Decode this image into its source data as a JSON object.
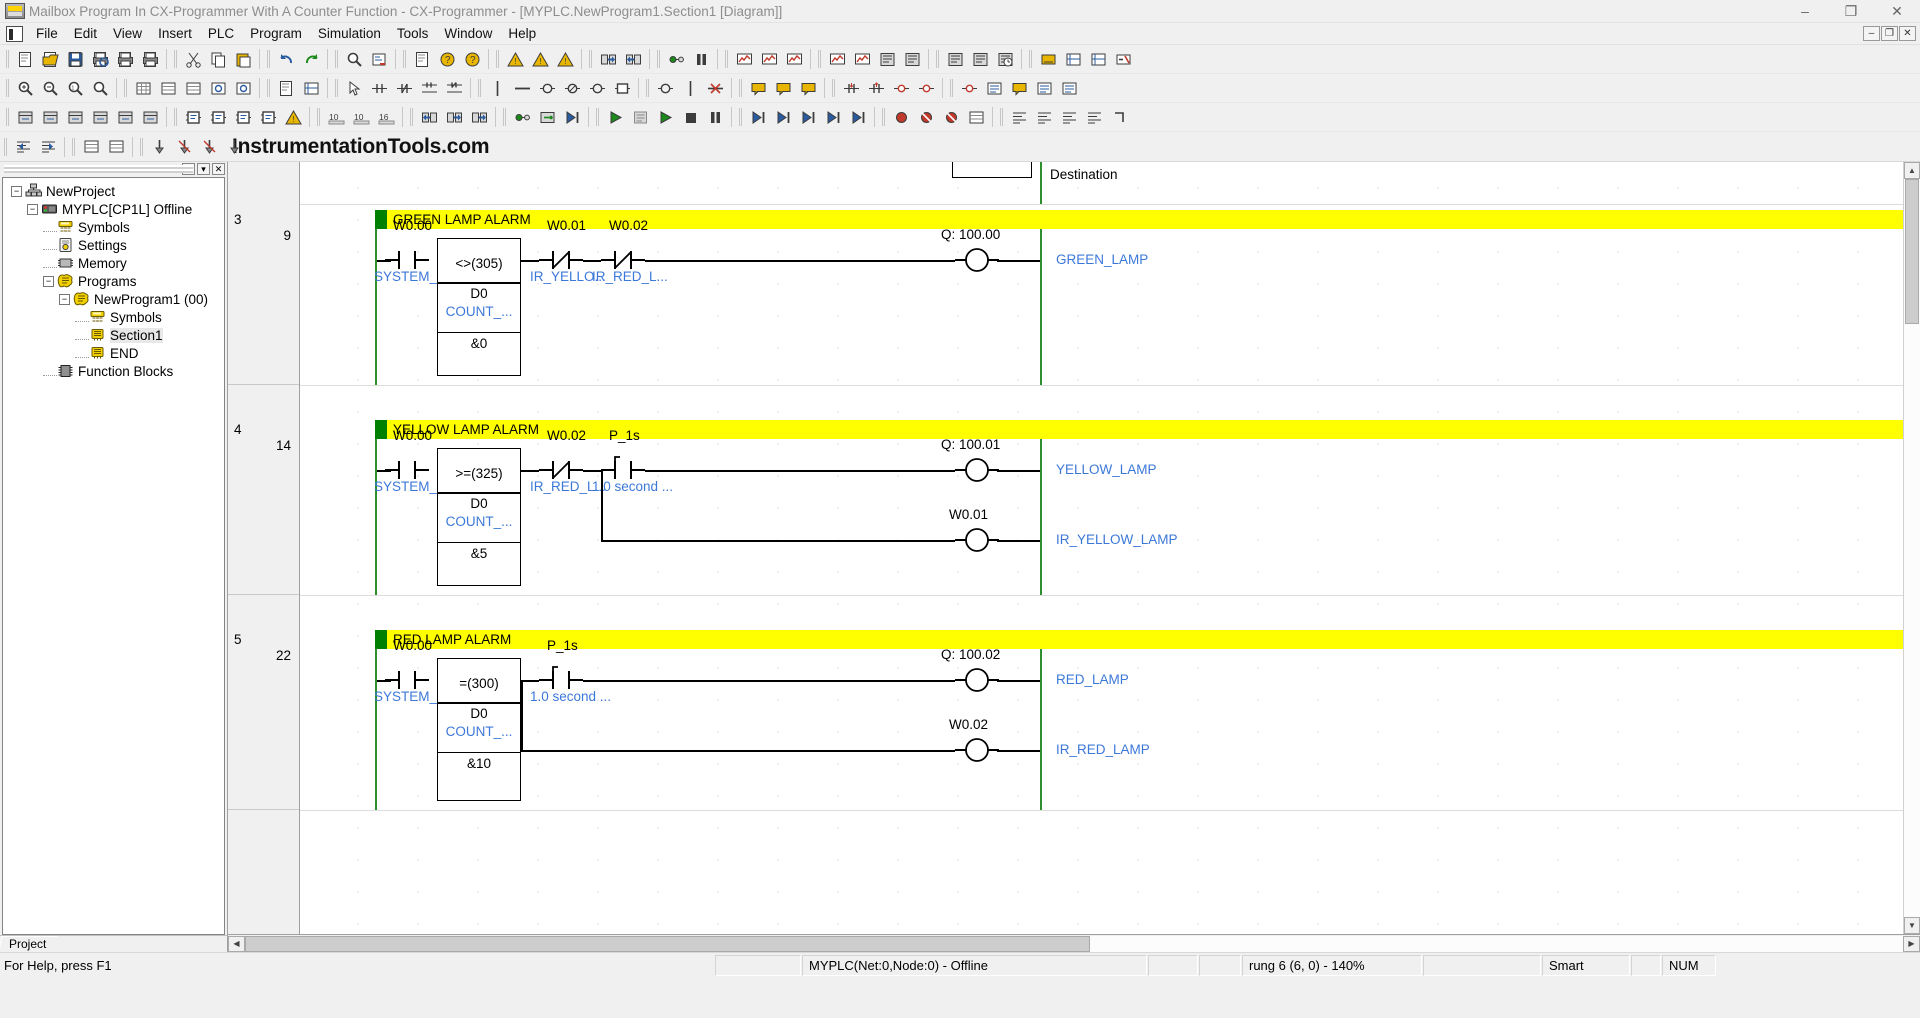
{
  "window": {
    "title": "Mailbox Program In CX-Programmer With A Counter Function - CX-Programmer - [MYPLC.NewProgram1.Section1 [Diagram]]",
    "app_icon": "plc-window-icon",
    "minimize": "–",
    "maximize": "❐",
    "close": "✕"
  },
  "menubar": {
    "icon": "document-icon",
    "items": [
      "File",
      "Edit",
      "View",
      "Insert",
      "PLC",
      "Program",
      "Simulation",
      "Tools",
      "Window",
      "Help"
    ],
    "mdi_buttons": [
      "–",
      "❐",
      "✕"
    ]
  },
  "watermark": {
    "text": "InstrumentationTools.com"
  },
  "toolbars": {
    "row1": [
      "new-icon",
      "open-icon",
      "save-icon",
      "print-preview-icon",
      "print-icon",
      "print-setup-icon",
      "cut-icon",
      "copy-icon",
      "paste-icon",
      "undo-icon",
      "redo-icon",
      "find-icon",
      "replace-icon",
      "properties-icon",
      "help-pointer-icon",
      "context-help-icon",
      "compile-error-icon",
      "compile-program-icon",
      "compile-plc-icon",
      "transfer-to-plc-icon",
      "transfer-from-plc-icon",
      "work-online-icon",
      "pause-icon",
      "monitor-icon",
      "monitor-stop-icon",
      "differential-monitor-icon",
      "data-trace-icon",
      "time-chart-icon",
      "cx-protocol-icon",
      "memory-view-icon",
      "io-table-icon",
      "plc-settings-icon",
      "plc-clock-icon",
      "symbols-icon",
      "address-ref-icon",
      "cross-ref-icon",
      "online-edit-icon"
    ],
    "row2": [
      "zoom-in-icon",
      "zoom-out-icon",
      "zoom-100-icon",
      "zoom-fit-icon",
      "grid-icon",
      "list-icon",
      "list-detail-icon",
      "watch-icon",
      "watch2-icon",
      "mnemonic-icon",
      "address-display-icon",
      "select-mode-icon",
      "new-contact-icon",
      "new-closed-contact-icon",
      "new-contact-or-icon",
      "new-closed-contact-or-icon",
      "new-vertical-icon",
      "new-horizontal-icon",
      "new-coil-icon",
      "new-closed-coil-icon",
      "new-pls-coil-icon",
      "new-instruction-icon",
      "new-output-icon",
      "vertical-line-icon",
      "delete-line-icon",
      "comment-icon",
      "rung-comment-icon",
      "annotation-icon",
      "up-differential-icon",
      "down-differential-icon",
      "invert-icon",
      "force-icon",
      "condition-icon",
      "show-symbol-icon",
      "show-comment-icon",
      "show-bar-icon",
      "show-rung-icon"
    ],
    "row3": [
      "view-1-icon",
      "view-2-icon",
      "view-3-icon",
      "view-4-icon",
      "view-5-icon",
      "view-6-icon",
      "fb-instance-icon",
      "fb-param-icon",
      "fb-ladder-icon",
      "fb-text-icon",
      "fb-compile-icon",
      "decimal-10-icon",
      "decimal-10-signed-icon",
      "hex-16-icon",
      "transfer-up-icon",
      "transfer-down-icon",
      "transfer-all-icon",
      "simulator-online-icon",
      "simulator-icon",
      "step-exec-icon",
      "scan-run-icon",
      "scan-pause-icon",
      "run-icon",
      "stop-icon",
      "pause2-icon",
      "step-in-icon",
      "step-out-icon",
      "step-over-icon",
      "continuous-step-icon",
      "run-to-cursor-icon",
      "break-set-icon",
      "break-clear-icon",
      "break-all-icon",
      "break-list-icon",
      "align-a-icon",
      "align-b-icon",
      "align-c-icon",
      "align-d-icon",
      "corner-icon"
    ],
    "row4": [
      "indent-left-icon",
      "indent-right-icon",
      "align-list-icon",
      "align-list2-icon",
      "pin-icon",
      "pin-off-icon",
      "pin-clear-icon",
      "pin-all-icon"
    ]
  },
  "project_tree": {
    "caption_buttons": [
      "–",
      "▾",
      "✕"
    ],
    "tab": "Project",
    "nodes": [
      {
        "label": "NewProject",
        "indent": 0,
        "expander": "−",
        "icon": "project-icon",
        "selected": false
      },
      {
        "label": "MYPLC[CP1L] Offline",
        "indent": 1,
        "expander": "−",
        "icon": "plc-icon",
        "selected": false
      },
      {
        "label": "Symbols",
        "indent": 2,
        "expander": "",
        "icon": "symbols-icon",
        "selected": false
      },
      {
        "label": "Settings",
        "indent": 2,
        "expander": "",
        "icon": "settings-icon",
        "selected": false
      },
      {
        "label": "Memory",
        "indent": 2,
        "expander": "",
        "icon": "memory-icon",
        "selected": false
      },
      {
        "label": "Programs",
        "indent": 2,
        "expander": "−",
        "icon": "programs-icon",
        "selected": false
      },
      {
        "label": "NewProgram1 (00)",
        "indent": 3,
        "expander": "−",
        "icon": "program-icon",
        "selected": false
      },
      {
        "label": "Symbols",
        "indent": 4,
        "expander": "",
        "icon": "symbols-icon",
        "selected": false
      },
      {
        "label": "Section1",
        "indent": 4,
        "expander": "",
        "icon": "section-icon",
        "selected": true
      },
      {
        "label": "END",
        "indent": 4,
        "expander": "",
        "icon": "section-icon",
        "selected": false
      },
      {
        "label": "Function Blocks",
        "indent": 2,
        "expander": "",
        "icon": "fb-icon",
        "selected": false
      }
    ]
  },
  "ladder": {
    "colors": {
      "comment_bg": "#ffff00",
      "comment_marker": "#008000",
      "power_rail": "#2f8f2f",
      "symbol_text": "#3c78d8",
      "wire": "#000000"
    },
    "partial_rung_top": {
      "destination_label": "Destination"
    },
    "rungs": [
      {
        "number": "3",
        "step": "9",
        "comment": "GREEN LAMP ALARM",
        "contacts": [
          {
            "address": "W0.00",
            "symbol": "SYSTEM_ON",
            "type": "normally-open"
          },
          {
            "address": "W0.01",
            "symbol": "IR_YELLO...",
            "type": "normally-closed"
          },
          {
            "address": "W0.02",
            "symbol": "IR_RED_L...",
            "type": "normally-closed"
          }
        ],
        "instruction": {
          "operator": "<>(305)",
          "operand": "D0",
          "operand_symbol": "COUNT_...",
          "constant": "&0"
        },
        "outputs": [
          {
            "address": "Q: 100.00",
            "symbol": "GREEN_LAMP",
            "type": "coil"
          }
        ]
      },
      {
        "number": "4",
        "step": "14",
        "comment": "YELLOW LAMP ALARM",
        "contacts": [
          {
            "address": "W0.00",
            "symbol": "SYSTEM_ON",
            "type": "normally-open"
          },
          {
            "address": "W0.02",
            "symbol": "IR_RED_L...",
            "type": "normally-closed"
          },
          {
            "address": "P_1s",
            "symbol": "1.0 second ...",
            "type": "up-differentiated"
          }
        ],
        "instruction": {
          "operator": ">=(325)",
          "operand": "D0",
          "operand_symbol": "COUNT_...",
          "constant": "&5"
        },
        "outputs": [
          {
            "address": "Q: 100.01",
            "symbol": "YELLOW_LAMP",
            "type": "coil"
          },
          {
            "address": "W0.01",
            "symbol": "IR_YELLOW_LAMP",
            "type": "coil"
          }
        ]
      },
      {
        "number": "5",
        "step": "22",
        "comment": "RED LAMP ALARM",
        "contacts": [
          {
            "address": "W0.00",
            "symbol": "SYSTEM_ON",
            "type": "normally-open"
          },
          {
            "address": "P_1s",
            "symbol": "1.0 second ...",
            "type": "up-differentiated"
          }
        ],
        "instruction": {
          "operator": "=(300)",
          "operand": "D0",
          "operand_symbol": "COUNT_...",
          "constant": "&10"
        },
        "outputs": [
          {
            "address": "Q: 100.02",
            "symbol": "RED_LAMP",
            "type": "coil"
          },
          {
            "address": "W0.02",
            "symbol": "IR_RED_LAMP",
            "type": "coil"
          }
        ]
      }
    ]
  },
  "statusbar": {
    "help": "For Help, press F1",
    "plc": "MYPLC(Net:0,Node:0) - Offline",
    "cell_a": "",
    "cell_b": "",
    "rung": "rung 6 (6, 0)  - 140%",
    "cell_c": "",
    "mode": "Smart",
    "cell_d": "",
    "num": "NUM"
  }
}
